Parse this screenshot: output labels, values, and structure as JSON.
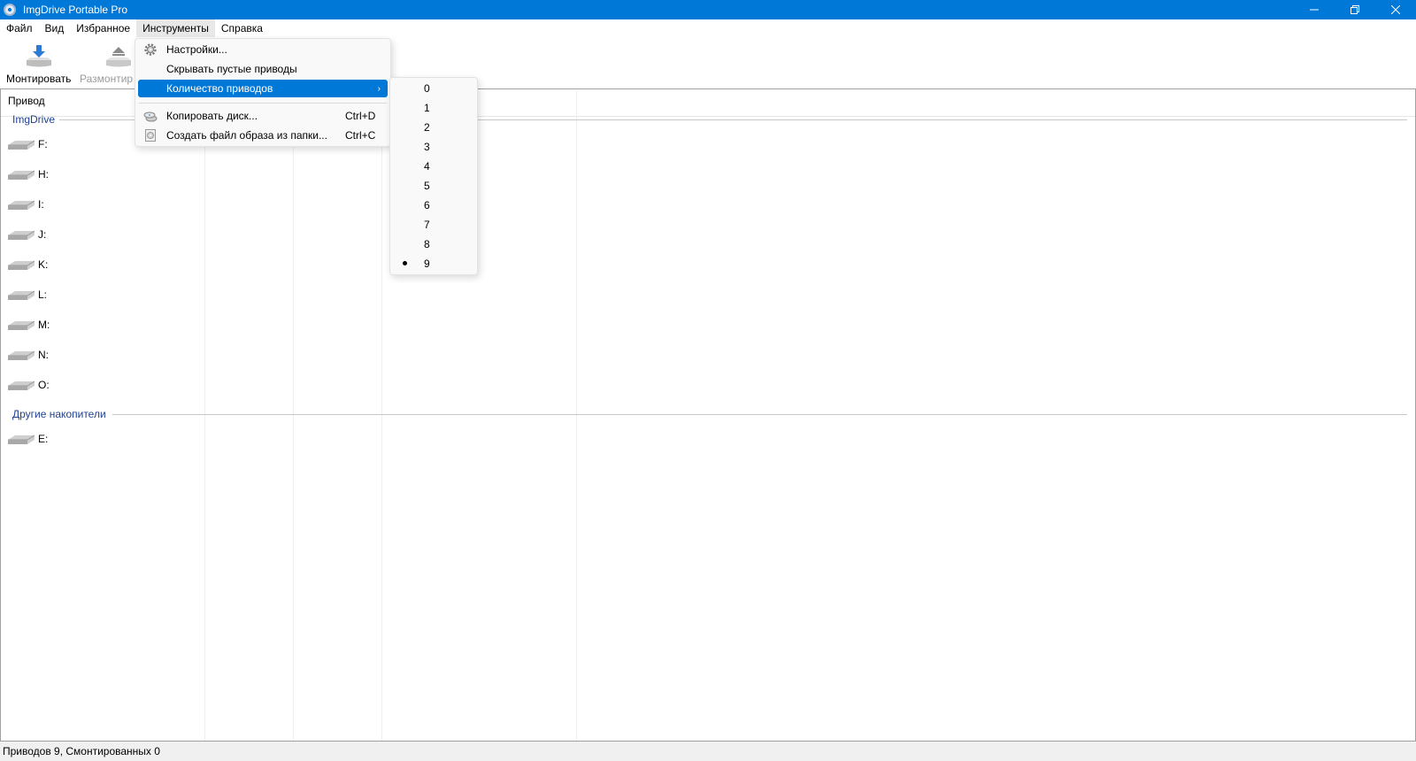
{
  "window": {
    "title": "ImgDrive Portable Pro",
    "controls": {
      "minimize": "—",
      "restore": "❐",
      "close": "✕"
    }
  },
  "menubar": {
    "items": [
      {
        "label": "Файл"
      },
      {
        "label": "Вид"
      },
      {
        "label": "Избранное"
      },
      {
        "label": "Инструменты"
      },
      {
        "label": "Справка"
      }
    ]
  },
  "toolbar": {
    "mount_label": "Монтировать",
    "unmount_label": "Размонтир"
  },
  "list": {
    "column_drive": "Привод",
    "groups": [
      {
        "label": "ImgDrive",
        "drives": [
          "F:",
          "H:",
          "I:",
          "J:",
          "K:",
          "L:",
          "M:",
          "N:",
          "O:"
        ]
      },
      {
        "label": "Другие накопители",
        "drives": [
          "E:"
        ]
      }
    ]
  },
  "tools_menu": {
    "settings": "Настройки...",
    "hide_empty": "Скрывать пустые приводы",
    "drive_count": "Количество приводов",
    "copy_disc": "Копировать диск...",
    "copy_disc_shortcut": "Ctrl+D",
    "create_image": "Создать файл образа из папки...",
    "create_image_shortcut": "Ctrl+C"
  },
  "drive_count_submenu": {
    "options": [
      "0",
      "1",
      "2",
      "3",
      "4",
      "5",
      "6",
      "7",
      "8",
      "9"
    ],
    "selected": "9"
  },
  "statusbar": {
    "text": "Приводов 9, Смонтированных 0"
  },
  "colors": {
    "titlebar": "#0078d7",
    "highlight": "#0078d7",
    "group_label": "#1e3f8f"
  }
}
